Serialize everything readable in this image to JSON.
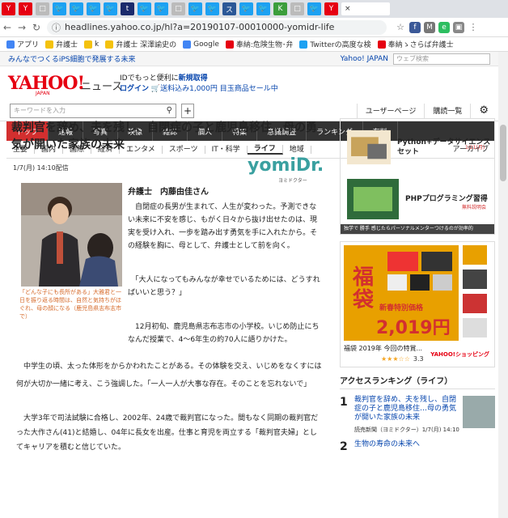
{
  "browser": {
    "url": "headlines.yahoo.co.jp/hl?a=20190107-00010000-yomidr-life",
    "tab_icons": [
      "Y",
      "Y",
      "□",
      "🐦",
      "🐦",
      "🐦",
      "🐦",
      "t",
      "🐦",
      "🐦",
      "□",
      "🐦",
      "🐦",
      "ス",
      "🐦",
      "🐦",
      "K",
      "□",
      "🐦",
      "Y"
    ],
    "close": "×",
    "bookmarks": [
      "アプリ",
      "弁護士",
      "k",
      "弁護士 深澤諭史の",
      "Google",
      "奉納:危険生物･弁",
      "Twitterの高度な検",
      "奉納ゝさらば弁護士"
    ]
  },
  "topstrip": {
    "promo": "みんなでつくるiPS細胞で発展する未来",
    "yahoo_japan": "Yahoo! JAPAN",
    "search_placeholder": "ウェブ検索"
  },
  "header": {
    "logo": "YAHOO!",
    "logo_sub": "JAPAN",
    "section": "ニュース",
    "login_line1_a": "IDでもっと便利に",
    "login_line1_b": "新規取得",
    "login_line2_a": "ログイン",
    "login_line2_b": "送料込み1,000円 目玉商品セール中"
  },
  "search": {
    "placeholder": "キーワードを入力",
    "plus": "+",
    "user_page": "ユーザーページ",
    "subscribe": "購読一覧"
  },
  "catnav": [
    "トップ",
    "速報",
    "写真",
    "映像",
    "雑誌",
    "個人",
    "特集",
    "意識調査",
    "ランキング",
    "有料"
  ],
  "subnav": [
    "主要",
    "国内",
    "国際",
    "経済",
    "エンタメ",
    "スポーツ",
    "IT・科学",
    "ライフ",
    "地域"
  ],
  "subnav_archive": "アーカイブ",
  "article": {
    "title": "裁判官を辞め、夫を残し、自閉症の子と鹿児島移住…母の勇気が開いた家族の未来",
    "date": "1/7(月) 14:10配信",
    "source_logo": "yomiDr.",
    "source_sub": "ヨミドクター",
    "author": "弁護士　内藤由佳さん",
    "caption": "「どんな子にも長所がある」大雅君と一日を振り返る時間は、自然と気持ちがほぐれ、母の顔になる（鹿児島県志布志市で）",
    "p1": "　自閉症の長男が生まれて、人生が変わった。予測できない未来に不安を感じ、もがく日々から抜け出せたのは、現実を受け入れ、一歩を踏み出す勇気を手に入れたから。その経験を胸に、母として、弁護士として前を向く。",
    "p2": "　「大人になってもみんなが幸せでいるためには、どうすればいいと思う？」",
    "p3": "　12月初旬、鹿児島県志布志市の小学校。いじめ防止にちなんだ授業で、4〜6年生の約70人に語りかけた。",
    "p4": "　中学生の頃、太った体形をからかわれたことがある。その体験を交え、いじめをなくすには何が大切か一緒に考え、こう強調した。「一人一人が大事な存在。そのことを忘れないで」",
    "p5": "　大学3年で司法試験に合格し、2002年、24歳で裁判官になった。間もなく同期の裁判官だった大作さん(41)と結婚し、04年に長女を出産。仕事と育児を両立する「裁判官夫婦」としてキャリアを積むと信じていた。"
  },
  "sidebar": {
    "ad1_item1": "Python+データサイエンスセット",
    "ad1_item1_date": "1/21(月)",
    "ad1_item2": "PHPプログラミング習得",
    "ad1_item2_sm": "無料説明会",
    "ad1_footer": "独学で 勝手 感じたらパーソナルメンターつけるのが効率的",
    "ad2_kanji": "福袋",
    "ad2_price_label": "新春特別価格",
    "ad2_price": "2,019円",
    "ad2_caption": "福袋 2019年 今回の特賞...",
    "ad2_rating": "3.3",
    "ad2_stars": "★★★☆☆",
    "ad2_shop": "YAHOO!ショッピング",
    "ranking_header": "アクセスランキング（ライフ）",
    "rank1_num": "1",
    "rank1_title": "裁判官を辞め、夫を残し、自閉症の子と鹿児島移住…母の勇気が開いた家族の未来",
    "rank1_meta": "読売新聞（ヨミドクター）1/7(月) 14:10",
    "rank2_num": "2",
    "rank2_title": "生物の寿命の未来へ"
  }
}
